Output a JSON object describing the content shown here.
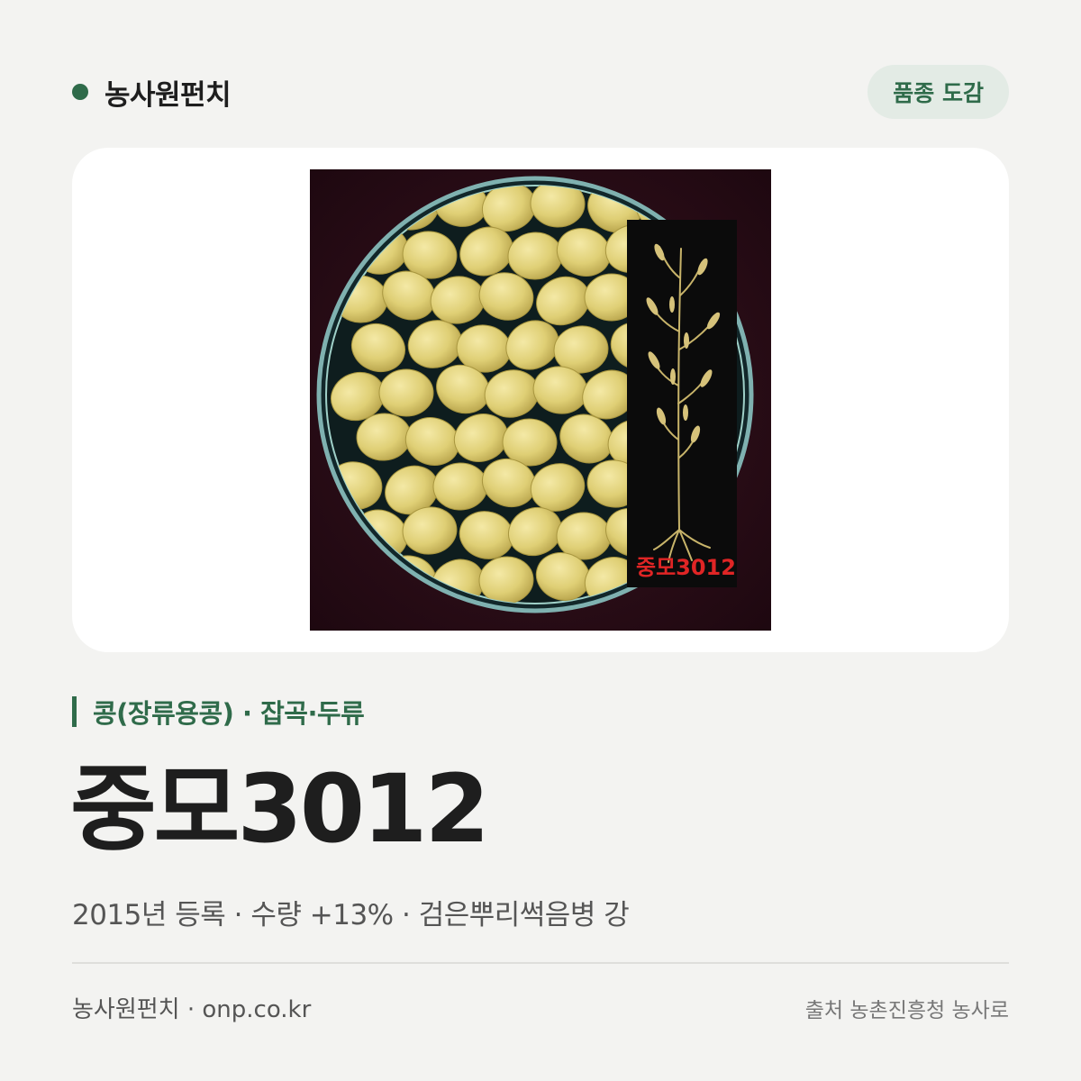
{
  "header": {
    "brand_name": "농사원펀치",
    "tag_label": "품종 도감"
  },
  "photo": {
    "overlay_label": "중모3012"
  },
  "category": {
    "text": "콩(장류용콩) · 잡곡·두류"
  },
  "variety": {
    "name": "중모3012",
    "summary": "2015년 등록 · 수량 +13% · 검은뿌리썩음병 강"
  },
  "footer": {
    "left_text": "농사원펀치 · onp.co.kr",
    "right_text": "출처 농촌진흥청 농사로"
  },
  "colors": {
    "accent": "#2f6b4a",
    "background": "#f3f3f1",
    "pill_background": "#e3ebe5"
  }
}
